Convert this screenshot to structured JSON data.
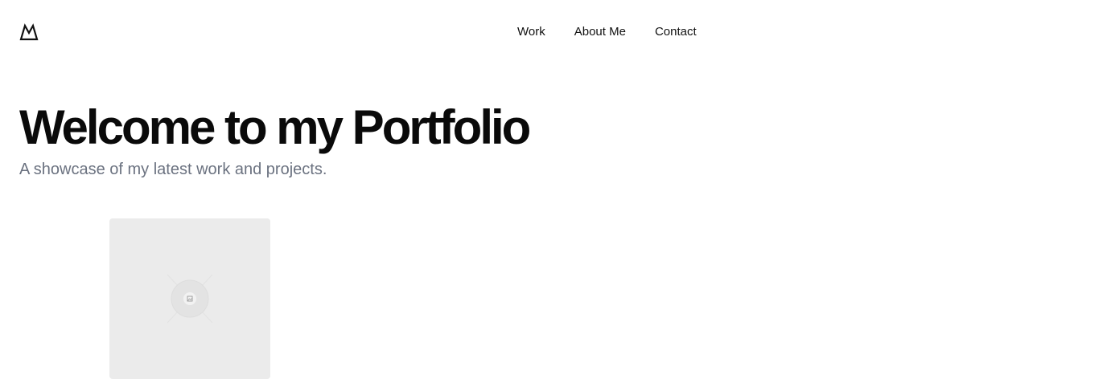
{
  "brand": {
    "logo_icon": "mountain-logo-icon"
  },
  "nav": {
    "items": [
      {
        "label": "Work"
      },
      {
        "label": "About Me"
      },
      {
        "label": "Contact"
      }
    ]
  },
  "hero": {
    "title": "Welcome to my Portfolio",
    "subtitle": "A showcase of my latest work and projects."
  },
  "projects": [
    {
      "thumbnail_icon": "image-placeholder-icon"
    }
  ],
  "colors": {
    "text": "#0a0a0a",
    "muted_text": "#6b7280",
    "card_background": "#ebebeb",
    "page_background": "#ffffff"
  }
}
